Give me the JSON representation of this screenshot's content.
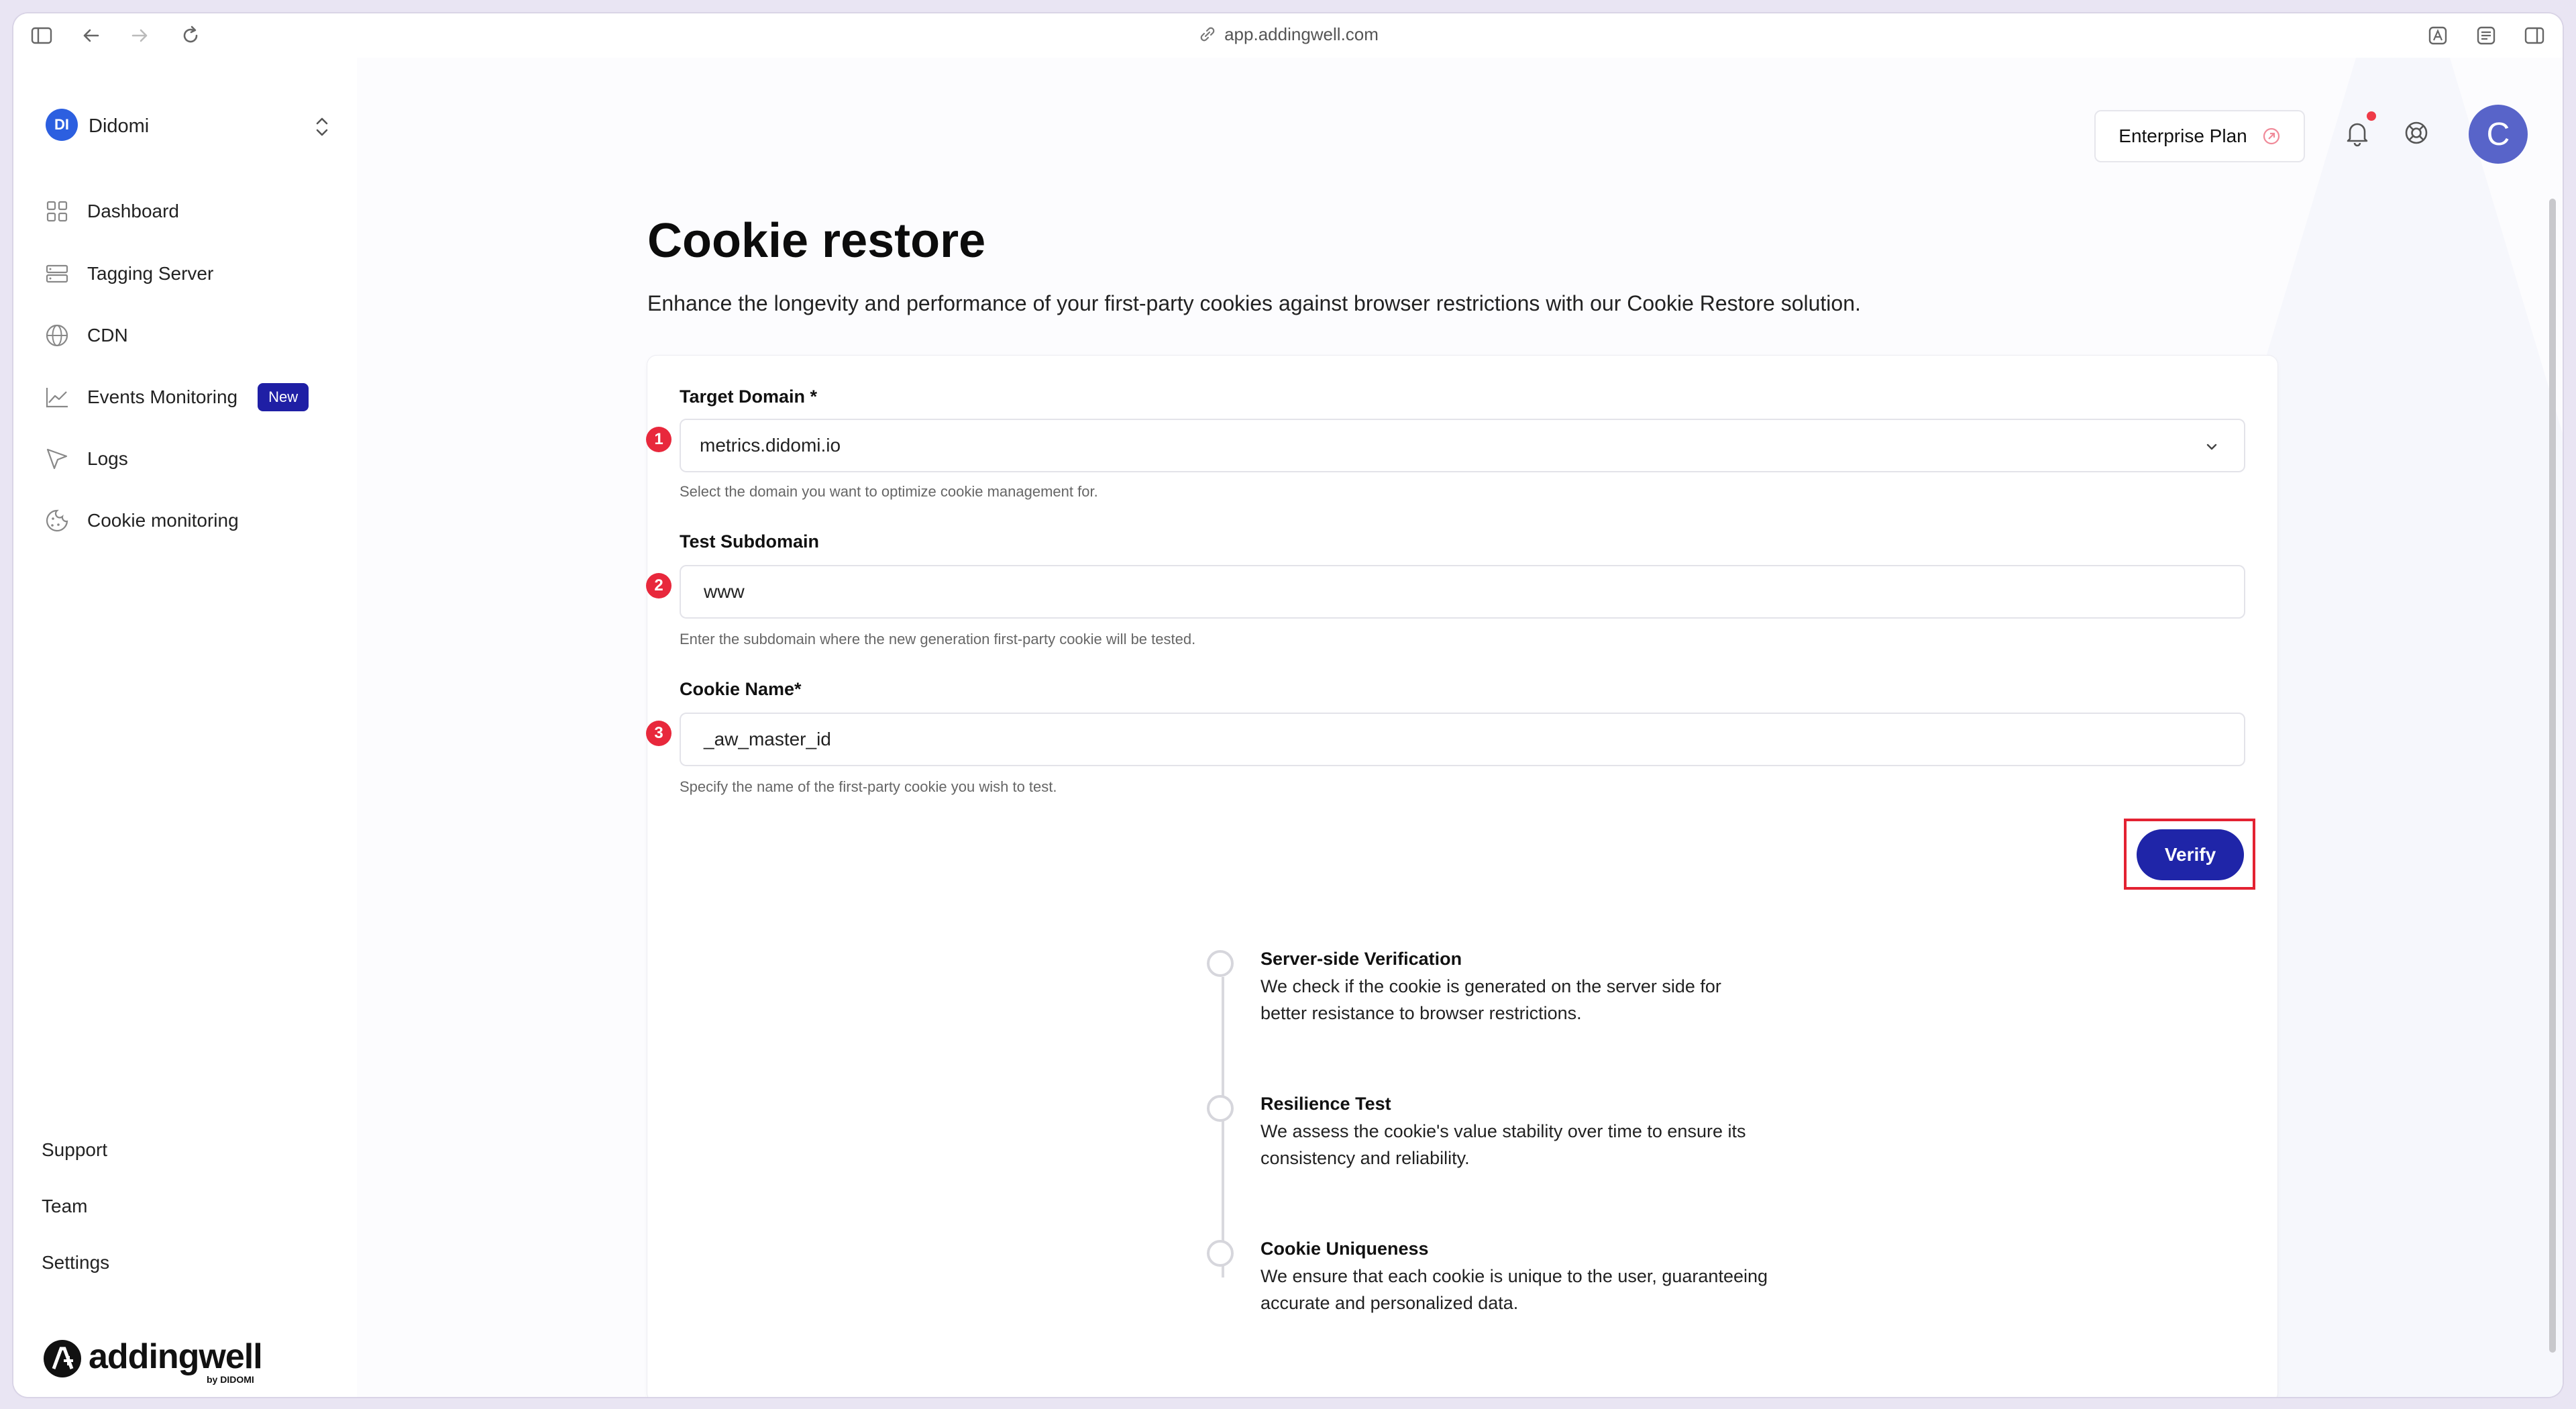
{
  "browser": {
    "url": "app.addingwell.com"
  },
  "sidebar": {
    "org": {
      "badge": "DI",
      "name": "Didomi"
    },
    "items": [
      {
        "label": "Dashboard",
        "icon": "grid-icon"
      },
      {
        "label": "Tagging Server",
        "icon": "server-icon"
      },
      {
        "label": "CDN",
        "icon": "globe-icon"
      },
      {
        "label": "Events Monitoring",
        "icon": "chart-icon",
        "badge": "New"
      },
      {
        "label": "Logs",
        "icon": "cursor-icon"
      },
      {
        "label": "Cookie monitoring",
        "icon": "cookie-icon"
      }
    ],
    "bottom": [
      "Support",
      "Team",
      "Settings"
    ],
    "brand": {
      "name": "addingwell",
      "sub": "by DIDOMI"
    }
  },
  "topbar": {
    "plan_label": "Enterprise Plan",
    "avatar_letter": "C"
  },
  "page": {
    "title": "Cookie restore",
    "description": "Enhance the longevity and performance of your first-party cookies against browser restrictions with our Cookie Restore solution."
  },
  "form": {
    "target_domain": {
      "label": "Target Domain *",
      "value": "metrics.didomi.io",
      "hint": "Select the domain you want to optimize cookie management for.",
      "marker": "1"
    },
    "test_subdomain": {
      "label": "Test Subdomain",
      "value": "www",
      "hint": "Enter the subdomain where the new generation first-party cookie will be tested.",
      "marker": "2"
    },
    "cookie_name": {
      "label": "Cookie Name*",
      "value": "_aw_master_id",
      "hint": "Specify the name of the first-party cookie you wish to test.",
      "marker": "3"
    },
    "verify_label": "Verify"
  },
  "steps": [
    {
      "title": "Server-side Verification",
      "desc": "We check if the cookie is generated on the server side for better resistance to browser restrictions."
    },
    {
      "title": "Resilience Test",
      "desc": "We assess the cookie's value stability over time to ensure its consistency and reliability."
    },
    {
      "title": "Cookie Uniqueness",
      "desc": "We ensure that each cookie is unique to the user, guaranteeing accurate and personalized data."
    }
  ],
  "colors": {
    "accent": "#1f25a8",
    "marker": "#e8283c",
    "badge": "#1f1fa5",
    "avatar": "#5864c9"
  }
}
